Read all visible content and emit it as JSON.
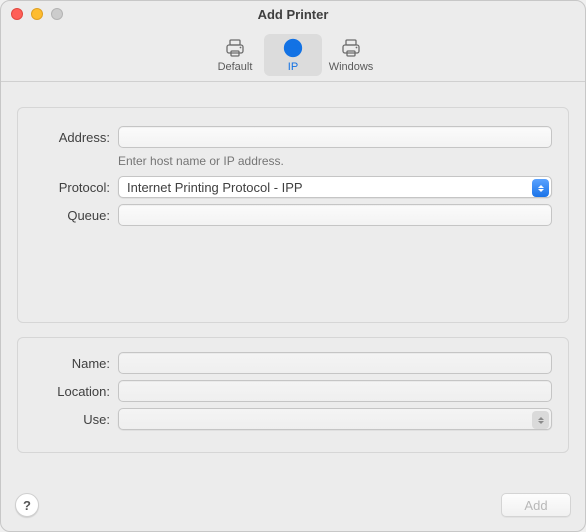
{
  "window": {
    "title": "Add Printer"
  },
  "tabs": {
    "default": "Default",
    "ip": "IP",
    "windows": "Windows",
    "selected": "ip"
  },
  "upper": {
    "address_label": "Address:",
    "address_value": "",
    "address_hint": "Enter host name or IP address.",
    "protocol_label": "Protocol:",
    "protocol_value": "Internet Printing Protocol - IPP",
    "queue_label": "Queue:",
    "queue_value": ""
  },
  "lower": {
    "name_label": "Name:",
    "name_value": "",
    "location_label": "Location:",
    "location_value": "",
    "use_label": "Use:",
    "use_value": ""
  },
  "footer": {
    "help_glyph": "?",
    "add_label": "Add"
  }
}
